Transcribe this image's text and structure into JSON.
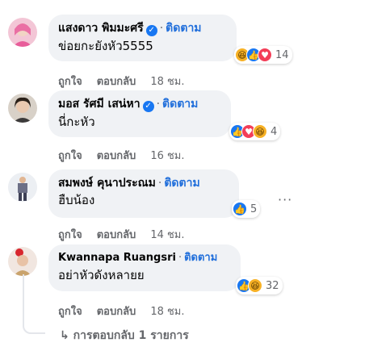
{
  "comments": [
    {
      "name": "แสงดาว พิมมะศรี",
      "verified": true,
      "follow": "ติดตาม",
      "text": "ข่อยกะยังหัว5555",
      "like": "ถูกใจ",
      "reply": "ตอบกลับ",
      "time": "18 ชม.",
      "reactions": [
        "haha",
        "like",
        "love"
      ],
      "reaction_count": "14"
    },
    {
      "name": "มอส รัศมี เสน่หา",
      "verified": true,
      "follow": "ติดตาม",
      "text": "นี่กะหัว",
      "like": "ถูกใจ",
      "reply": "ตอบกลับ",
      "time": "16 ชม.",
      "reactions": [
        "like",
        "love",
        "haha"
      ],
      "reaction_count": "4"
    },
    {
      "name": "สมพงษ์ คุนาประณม",
      "verified": false,
      "follow": "ติดตาม",
      "text": "ฮืบน้อง",
      "like": "ถูกใจ",
      "reply": "ตอบกลับ",
      "time": "14 ชม.",
      "reactions": [
        "like"
      ],
      "reaction_count": "5"
    },
    {
      "name": "Kwannapa Ruangsri",
      "verified": false,
      "follow": "ติดตาม",
      "text": "อย่าหัวดังหลายย",
      "like": "ถูกใจ",
      "reply": "ตอบกลับ",
      "time": "18 ชม.",
      "reactions": [
        "like",
        "haha"
      ],
      "reaction_count": "32"
    }
  ],
  "more_options": "···",
  "replies_link": "การตอบกลับ 1 รายการ",
  "colors": {
    "bubble": "#f0f2f5",
    "follow": "#216fdb",
    "meta": "#65676b",
    "verified": "#1877f2"
  }
}
